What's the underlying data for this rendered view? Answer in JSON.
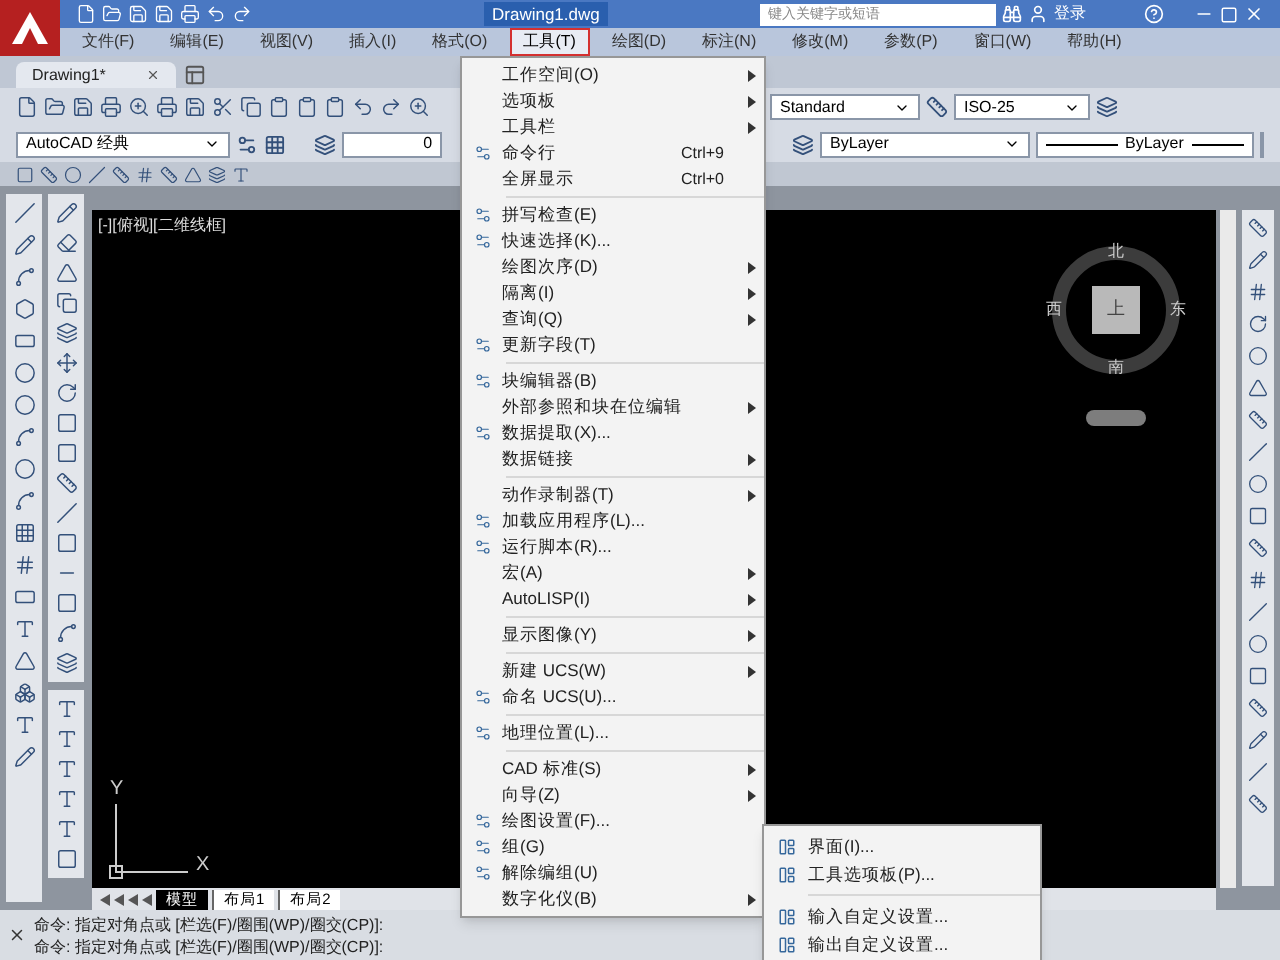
{
  "window": {
    "title": "Drawing1.dwg",
    "search": {
      "placeholder": "键入关键字或短语"
    },
    "user": "登录"
  },
  "menubar": [
    {
      "label": "文件(F)",
      "selected": false
    },
    {
      "label": "编辑(E)",
      "selected": false
    },
    {
      "label": "视图(V)",
      "selected": false
    },
    {
      "label": "插入(I)",
      "selected": false
    },
    {
      "label": "格式(O)",
      "selected": false
    },
    {
      "label": "工具(T)",
      "selected": true
    },
    {
      "label": "绘图(D)",
      "selected": false
    },
    {
      "label": "标注(N)",
      "selected": false
    },
    {
      "label": "修改(M)",
      "selected": false
    },
    {
      "label": "参数(P)",
      "selected": false
    },
    {
      "label": "窗口(W)",
      "selected": false
    },
    {
      "label": "帮助(H)",
      "selected": false
    }
  ],
  "doc_tabs": [
    {
      "label": "Drawing1*",
      "selected": true
    }
  ],
  "toolbar": {
    "text_style": "Standard",
    "dim_style": "ISO-25",
    "workspace": "AutoCAD 经典",
    "layer": "0",
    "color_control": "ByLayer",
    "linetype": "ByLayer"
  },
  "viewport": {
    "label": "[-][俯视][二维线框]",
    "viewcube": {
      "top": "上",
      "north": "北",
      "south": "南",
      "east": "东",
      "west": "西"
    },
    "ucs": {
      "x": "X",
      "y": "Y"
    }
  },
  "layout_tabs": [
    {
      "label": "模型",
      "selected": true
    },
    {
      "label": "布局1",
      "selected": false
    },
    {
      "label": "布局2",
      "selected": false
    }
  ],
  "command_lines": [
    "命令: 指定对角点或 [栏选(F)/圈围(WP)/圈交(CP)]:",
    "命令: 指定对角点或 [栏选(F)/圈围(WP)/圈交(CP)]:"
  ],
  "tools_menu": {
    "groups": [
      [
        {
          "label": "工作空间(O)",
          "submenu": true,
          "icon": false
        },
        {
          "label": "选项板",
          "submenu": true,
          "icon": false
        },
        {
          "label": "工具栏",
          "submenu": true,
          "icon": false
        },
        {
          "label": "命令行",
          "shortcut": "Ctrl+9",
          "submenu": false,
          "icon": true
        },
        {
          "label": "全屏显示",
          "shortcut": "Ctrl+0",
          "submenu": false,
          "icon": false
        }
      ],
      [
        {
          "label": "拼写检查(E)",
          "submenu": false,
          "icon": true
        },
        {
          "label": "快速选择(K)...",
          "submenu": false,
          "icon": true
        },
        {
          "label": "绘图次序(D)",
          "submenu": true,
          "icon": false
        },
        {
          "label": "隔离(I)",
          "submenu": true,
          "icon": false
        },
        {
          "label": "查询(Q)",
          "submenu": true,
          "icon": false
        },
        {
          "label": "更新字段(T)",
          "submenu": false,
          "icon": true
        }
      ],
      [
        {
          "label": "块编辑器(B)",
          "submenu": false,
          "icon": true
        },
        {
          "label": "外部参照和块在位编辑",
          "submenu": true,
          "icon": false
        },
        {
          "label": "数据提取(X)...",
          "submenu": false,
          "icon": true
        },
        {
          "label": "数据链接",
          "submenu": true,
          "icon": false
        }
      ],
      [
        {
          "label": "动作录制器(T)",
          "submenu": true,
          "icon": false
        },
        {
          "label": "加载应用程序(L)...",
          "submenu": false,
          "icon": true
        },
        {
          "label": "运行脚本(R)...",
          "submenu": false,
          "icon": true
        },
        {
          "label": "宏(A)",
          "submenu": true,
          "icon": false
        },
        {
          "label": "AutoLISP(I)",
          "submenu": true,
          "icon": false
        }
      ],
      [
        {
          "label": "显示图像(Y)",
          "submenu": true,
          "icon": false
        }
      ],
      [
        {
          "label": "新建 UCS(W)",
          "submenu": true,
          "icon": false
        },
        {
          "label": "命名 UCS(U)...",
          "submenu": false,
          "icon": true
        }
      ],
      [
        {
          "label": "地理位置(L)...",
          "submenu": false,
          "icon": true
        }
      ],
      [
        {
          "label": "CAD 标准(S)",
          "submenu": true,
          "icon": false
        },
        {
          "label": "向导(Z)",
          "submenu": true,
          "icon": false
        },
        {
          "label": "绘图设置(F)...",
          "submenu": false,
          "icon": true
        },
        {
          "label": "组(G)",
          "submenu": false,
          "icon": true
        },
        {
          "label": "解除编组(U)",
          "submenu": false,
          "icon": true
        },
        {
          "label": "数字化仪(B)",
          "submenu": true,
          "icon": false
        }
      ]
    ]
  },
  "customize_submenu": {
    "groups": [
      [
        {
          "label": "界面(I)..."
        },
        {
          "label": "工具选项板(P)..."
        }
      ],
      [
        {
          "label": "输入自定义设置..."
        },
        {
          "label": "输出自定义设置..."
        }
      ]
    ]
  }
}
